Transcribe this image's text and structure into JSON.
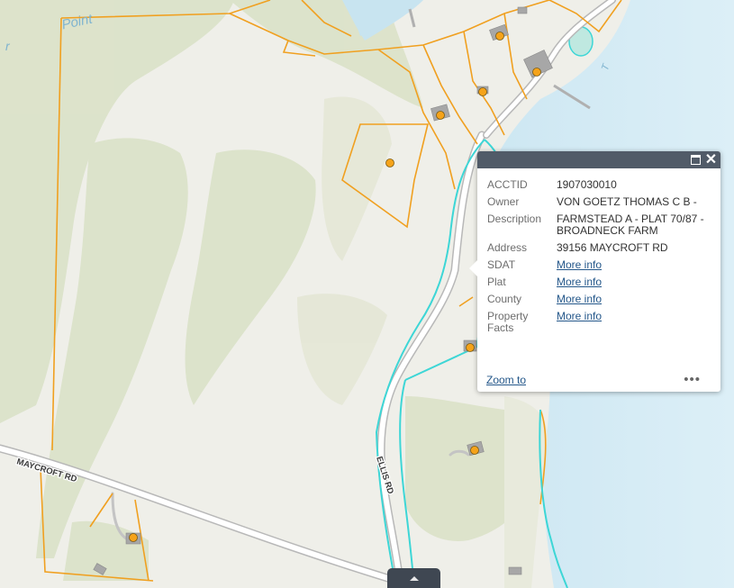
{
  "map": {
    "road_labels": {
      "maycroft": "MAYCROFT RD",
      "ellis": "ELLIS RD"
    },
    "water_labels": {
      "point_fragment": "Point",
      "partial_r": "r",
      "partial_t": "T"
    },
    "colors": {
      "parcel_outline": "#f0a020",
      "selected_outline": "#3dd6d6",
      "water": "#cfe7f2",
      "land": "#efefe9",
      "vegetation": "#d4ddbf",
      "marker": "#f5a31a"
    }
  },
  "popup": {
    "fields": [
      {
        "key": "ACCTID",
        "value": "1907030010"
      },
      {
        "key": "Owner",
        "value": "VON GOETZ THOMAS C B -"
      },
      {
        "key": "Description",
        "value": "FARMSTEAD A - PLAT 70/87 - BROADNECK FARM"
      },
      {
        "key": "Address",
        "value": "39156 MAYCROFT RD"
      },
      {
        "key": "SDAT",
        "value": "More info"
      },
      {
        "key": "Plat",
        "value": "More info"
      },
      {
        "key": "County",
        "value": "More info"
      },
      {
        "key": "Property Facts",
        "value": "More info"
      }
    ],
    "zoom_label": "Zoom to",
    "more_glyph": "•••",
    "close_glyph": "✕"
  }
}
